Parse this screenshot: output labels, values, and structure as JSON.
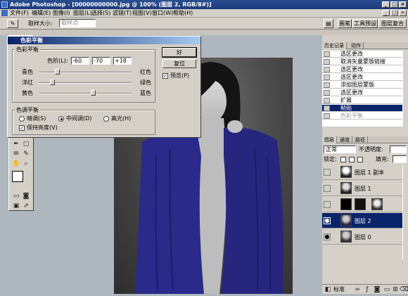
{
  "window": {
    "title": "Adobe Photoshop - [00000000000.jpg @ 100% (图层 2, RGB/8#)]"
  },
  "menu": [
    "文件(F)",
    "编辑(E)",
    "图像(I)",
    "图层(L)",
    "选择(S)",
    "滤镜(T)",
    "视图(V)",
    "窗口(W)",
    "帮助(H)"
  ],
  "options": {
    "sample_label": "取样大小:",
    "sample_value": "取样点",
    "tab_brushes": "画笔",
    "tab_presets": "工具预设",
    "tab_comps": "图层复合"
  },
  "dialog": {
    "title": "色彩平衡",
    "group_balance": "色彩平衡",
    "levels_label": "色阶(L):",
    "level1": "-60",
    "level2": "-70",
    "level3": "+18",
    "row1_left": "青色",
    "row1_right": "红色",
    "row2_left": "洋红",
    "row2_right": "绿色",
    "row3_left": "黄色",
    "row3_right": "蓝色",
    "slider_values": [
      -60,
      -70,
      18
    ],
    "group_tone": "色调平衡",
    "shadows": "暗调(S)",
    "midtones": "中间调(D)",
    "highlights": "高光(H)",
    "selected_tone": "中间调(D)",
    "preserve": "保持亮度(V)",
    "preserve_checked": true,
    "ok": "好",
    "reset": "复位",
    "preview": "预览(P)",
    "preview_checked": true
  },
  "history": {
    "tabs": [
      "历史记录",
      "动作"
    ],
    "items": [
      {
        "label": "选区更改",
        "state": "normal"
      },
      {
        "label": "取消矢量蒙版链接",
        "state": "normal"
      },
      {
        "label": "选区更改",
        "state": "normal"
      },
      {
        "label": "选区更改",
        "state": "normal"
      },
      {
        "label": "添加图层蒙版",
        "state": "normal"
      },
      {
        "label": "选区更改",
        "state": "normal"
      },
      {
        "label": "扩展",
        "state": "normal"
      },
      {
        "label": "粘贴",
        "state": "selected"
      },
      {
        "label": "色彩平衡",
        "state": "dimmed"
      }
    ]
  },
  "layers": {
    "tabs": [
      "图层",
      "通道",
      "路径"
    ],
    "blend_mode": "正常",
    "opacity_label": "不透明度:",
    "lock_label": "锁定:",
    "fill_label": "填充:",
    "items": [
      {
        "name": "图层 1 副本",
        "selected": false
      },
      {
        "name": "图层 1",
        "selected": false
      },
      {
        "name": "",
        "selected": false
      },
      {
        "name": "图层 2",
        "selected": true
      },
      {
        "name": "图层 0",
        "selected": false
      }
    ]
  },
  "status": {
    "standard": "标准"
  },
  "colors": {
    "title_bar": "#1c3a78",
    "panel": "#d4d0c8",
    "selection": "#0a246a",
    "canvas_bg": "#aeb6be",
    "robe": "#2a2a8a"
  }
}
